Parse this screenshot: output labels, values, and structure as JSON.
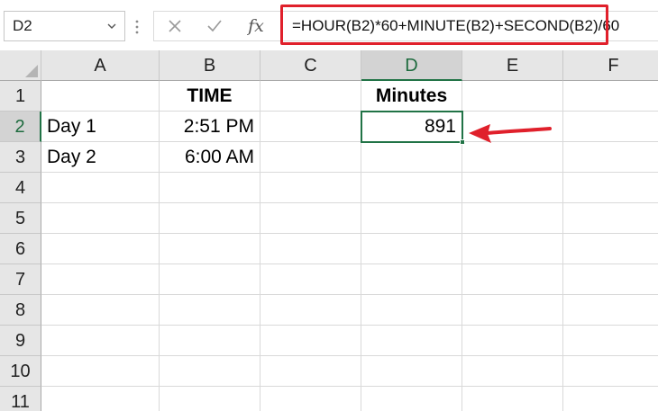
{
  "formula_bar": {
    "name_box": "D2",
    "cancel_icon": "close-icon",
    "enter_icon": "check-icon",
    "function_icon": "fx-icon",
    "function_label": "fx",
    "formula": "=HOUR(B2)*60+MINUTE(B2)+SECOND(B2)/60"
  },
  "columns": [
    "A",
    "B",
    "C",
    "D",
    "E",
    "F"
  ],
  "rows": [
    "1",
    "2",
    "3",
    "4",
    "5",
    "6",
    "7",
    "8",
    "9",
    "10",
    "11"
  ],
  "active_cell": {
    "column": "D",
    "row": "2"
  },
  "cells": {
    "B1": "TIME",
    "D1": "Minutes",
    "A2": "Day 1",
    "B2": "2:51 PM",
    "D2": "891",
    "A3": "Day 2",
    "B3": "6:00 AM"
  },
  "colors": {
    "highlight": "#e0202b",
    "selection": "#217346",
    "header_bg": "#e6e6e6"
  }
}
